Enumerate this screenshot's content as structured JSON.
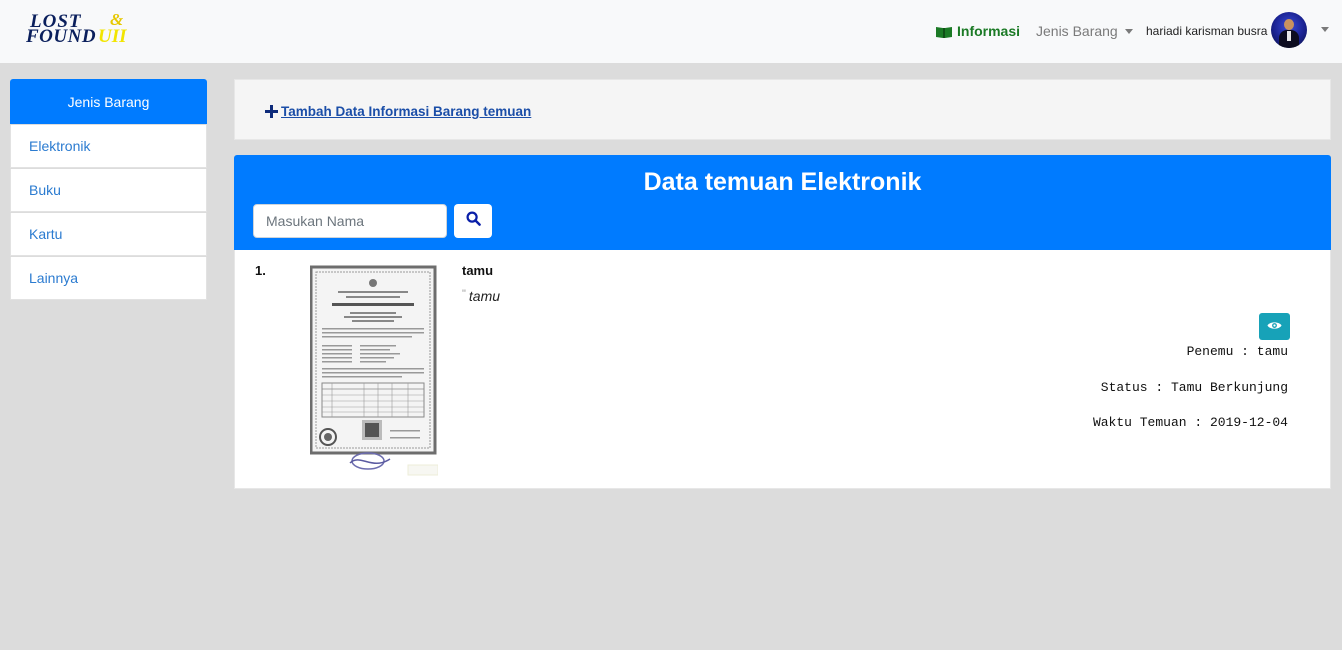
{
  "navbar": {
    "logo": {
      "line1": "LOST",
      "amp": "&",
      "line2": "FOUND",
      "suffix": "UII"
    },
    "info_label": "Informasi",
    "jenis_label": "Jenis Barang",
    "user_name": "hariadi karisman busra"
  },
  "sidebar": {
    "header": "Jenis Barang",
    "items": [
      {
        "label": "Elektronik"
      },
      {
        "label": "Buku"
      },
      {
        "label": "Kartu"
      },
      {
        "label": "Lainnya"
      }
    ]
  },
  "add_panel": {
    "link_label": "Tambah Data Informasi Barang temuan"
  },
  "data_panel": {
    "title": "Data temuan Elektronik",
    "search": {
      "placeholder": "Masukan Nama",
      "value": ""
    },
    "items": [
      {
        "number": "1.",
        "name": "tamu",
        "quote_mark": "\"",
        "description": "tamu",
        "penemu": "Penemu : tamu",
        "status": "Status : Tamu Berkunjung",
        "waktu": "Waktu Temuan : 2019-12-04"
      }
    ]
  },
  "colors": {
    "primary": "#007bff",
    "info_green": "#1b7a25",
    "view_button": "#17a2b8",
    "link_blue": "#1b4ea8",
    "page_bg": "#dcdcdc"
  },
  "icons": {
    "info": "book-icon",
    "search": "search-icon",
    "view": "eye-icon",
    "add": "plus-icon"
  }
}
